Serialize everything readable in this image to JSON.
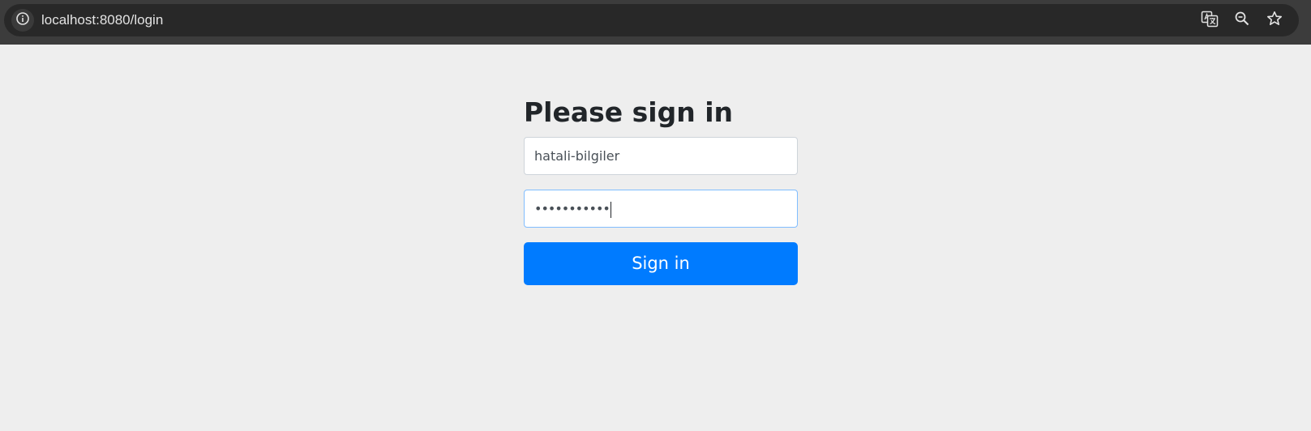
{
  "browser": {
    "url": "localhost:8080/login",
    "icons": {
      "site_info": "info-icon",
      "translate": "translate-icon",
      "zoom": "zoom-out-icon",
      "bookmark": "star-icon"
    }
  },
  "page": {
    "heading": "Please sign in",
    "username_value": "hatali-bilgiler",
    "password_value": "•••••••••••",
    "submit_label": "Sign in"
  },
  "colors": {
    "background": "#eeeeee",
    "primary": "#007bff",
    "focus_border": "#80bdff",
    "heading_text": "#212529"
  }
}
